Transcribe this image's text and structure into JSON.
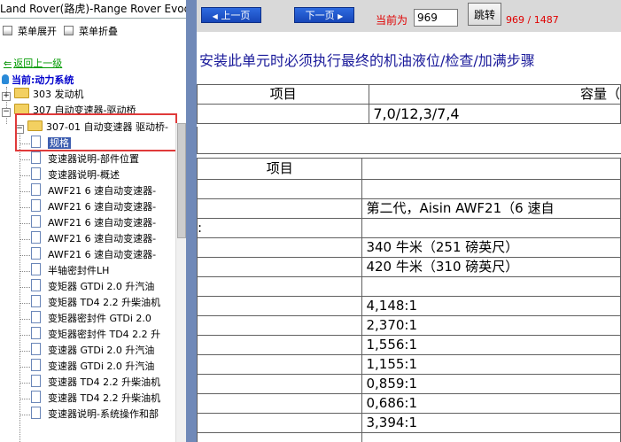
{
  "left_panel": {
    "title": "Land Rover(路虎)-Range Rover Evoque",
    "expand_label": "菜单展开",
    "collapse_label": "菜单折叠",
    "back_label": "返回上一级",
    "current_label": "当前:动力系统",
    "tree": {
      "node_303": "303 发动机",
      "node_307": "307 自动变速器-驱动桥",
      "node_30701": "307-01 自动变速器 驱动桥-",
      "items": [
        "规格",
        "变速器说明-部件位置",
        "变速器说明-概述",
        "AWF21 6 速自动变速器-",
        "AWF21 6 速自动变速器-",
        "AWF21 6 速自动变速器-",
        "AWF21 6 速自动变速器-",
        "AWF21 6 速自动变速器-",
        "半轴密封件LH",
        "变矩器 GTDi 2.0 升汽油",
        "变矩器 TD4 2.2 升柴油机",
        "变矩器密封件 GTDi 2.0",
        "变矩器密封件 TD4 2.2 升",
        "变速器 GTDi 2.0 升汽油",
        "变速器 GTDi 2.0 升汽油",
        "变速器 TD4 2.2 升柴油机",
        "变速器 TD4 2.2 升柴油机",
        "变速器说明-系统操作和部"
      ]
    }
  },
  "toolbar": {
    "prev_label": "上一页",
    "next_label": "下一页",
    "current_label": "当前为",
    "page_value": "969",
    "jump_label": "跳转",
    "total": "969 / 1487"
  },
  "content": {
    "heading": "安装此单元时必须执行最终的机油液位/检查/加满步骤",
    "table1": {
      "header_item": "项目",
      "header_capacity": "容量（",
      "capacity_value": "7,0/12,3/7,4"
    },
    "table2": {
      "header_item": "项目",
      "rows": [
        "",
        "第二代，Aisin AWF21（6 速自",
        "",
        "340 牛米（251 磅英尺）",
        "420 牛米（310 磅英尺）",
        "",
        "4,148:1",
        "2,370:1",
        "1,556:1",
        "1,155:1",
        "0,859:1",
        "0,686:1",
        "3,394:1",
        ""
      ],
      "row_colon": ":"
    }
  },
  "colors": {
    "divider": "#7089b8",
    "heading": "#1a1a9a",
    "red": "#e00000",
    "highlight_box": "#e03a3a",
    "button_blue": "#1746b8"
  }
}
